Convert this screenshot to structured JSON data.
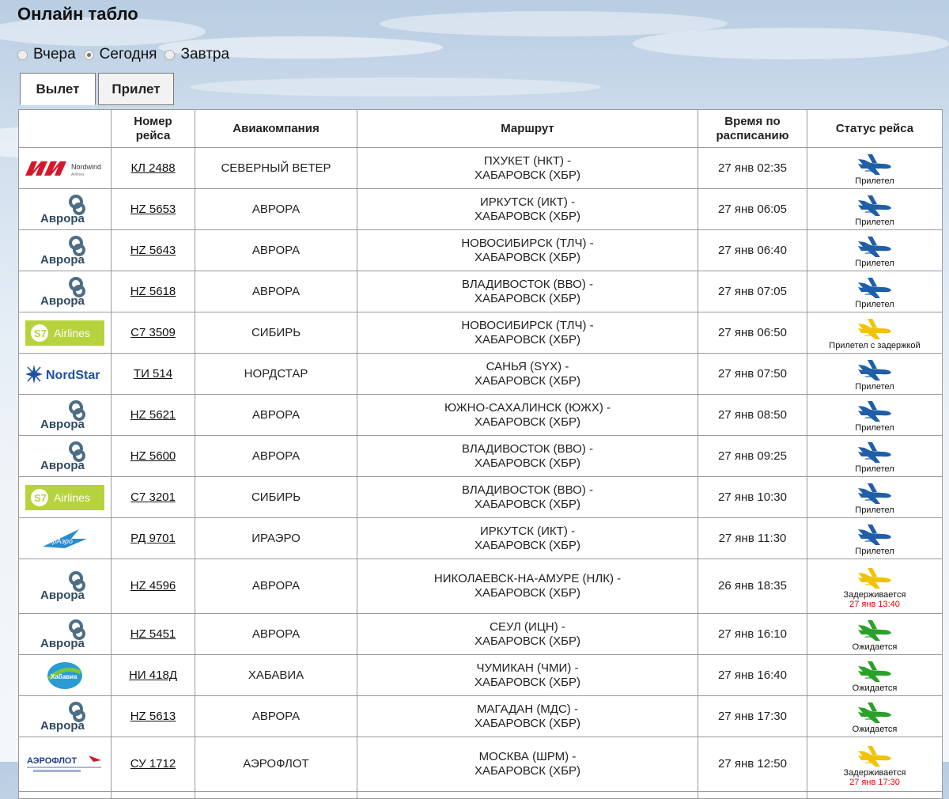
{
  "page": {
    "title": "Онлайн табло",
    "days": [
      {
        "label": "Вчера",
        "selected": false
      },
      {
        "label": "Сегодня",
        "selected": true
      },
      {
        "label": "Завтра",
        "selected": false
      }
    ],
    "tabs": [
      {
        "label": "Вылет",
        "active": true
      },
      {
        "label": "Прилет",
        "active": false
      }
    ]
  },
  "table": {
    "headers": {
      "logo": "",
      "flight": "Номер рейса",
      "airline": "Авиакомпания",
      "route": "Маршрут",
      "time": "Время по расписанию",
      "status": "Статус рейса"
    },
    "rows": [
      {
        "logo": "nordwind-logo",
        "logo_text": "Nordwind",
        "flight": "КЛ 2488",
        "airline": "СЕВЕРНЫЙ ВЕТЕР",
        "route1": "ПХУКЕТ (НКТ) -",
        "route2": "ХАБАРОВСК (ХБР)",
        "time": "27 янв 02:35",
        "status": "Прилетел",
        "status_color": "#1f5fa8",
        "status_time": ""
      },
      {
        "logo": "aurora-logo",
        "logo_text": "Аврора",
        "flight": "HZ 5653",
        "airline": "АВРОРА",
        "route1": "ИРКУТСК (ИКТ) -",
        "route2": "ХАБАРОВСК (ХБР)",
        "time": "27 янв 06:05",
        "status": "Прилетел",
        "status_color": "#1f5fa8",
        "status_time": ""
      },
      {
        "logo": "aurora-logo",
        "logo_text": "Аврора",
        "flight": "HZ 5643",
        "airline": "АВРОРА",
        "route1": "НОВОСИБИРСК (ТЛЧ) -",
        "route2": "ХАБАРОВСК (ХБР)",
        "time": "27 янв 06:40",
        "status": "Прилетел",
        "status_color": "#1f5fa8",
        "status_time": ""
      },
      {
        "logo": "aurora-logo",
        "logo_text": "Аврора",
        "flight": "HZ 5618",
        "airline": "АВРОРА",
        "route1": "ВЛАДИВОСТОК (ВВО) -",
        "route2": "ХАБАРОВСК (ХБР)",
        "time": "27 янв 07:05",
        "status": "Прилетел",
        "status_color": "#1f5fa8",
        "status_time": ""
      },
      {
        "logo": "s7-logo",
        "logo_text": "Airlines",
        "flight": "С7 3509",
        "airline": "СИБИРЬ",
        "route1": "НОВОСИБИРСК (ТЛЧ) -",
        "route2": "ХАБАРОВСК (ХБР)",
        "time": "27 янв 06:50",
        "status": "Прилетел с задержкой",
        "status_color": "#f2c200",
        "status_time": ""
      },
      {
        "logo": "nordstar-logo",
        "logo_text": "NordStar",
        "flight": "ТИ 514",
        "airline": "НОРДСТАР",
        "route1": "САНЬЯ (SYX) -",
        "route2": "ХАБАРОВСК (ХБР)",
        "time": "27 янв 07:50",
        "status": "Прилетел",
        "status_color": "#1f5fa8",
        "status_time": ""
      },
      {
        "logo": "aurora-logo",
        "logo_text": "Аврора",
        "flight": "HZ 5621",
        "airline": "АВРОРА",
        "route1": "ЮЖНО-САХАЛИНСК (ЮЖХ) -",
        "route2": "ХАБАРОВСК (ХБР)",
        "time": "27 янв 08:50",
        "status": "Прилетел",
        "status_color": "#1f5fa8",
        "status_time": ""
      },
      {
        "logo": "aurora-logo",
        "logo_text": "Аврора",
        "flight": "HZ 5600",
        "airline": "АВРОРА",
        "route1": "ВЛАДИВОСТОК (ВВО) -",
        "route2": "ХАБАРОВСК (ХБР)",
        "time": "27 янв 09:25",
        "status": "Прилетел",
        "status_color": "#1f5fa8",
        "status_time": ""
      },
      {
        "logo": "s7-logo",
        "logo_text": "Airlines",
        "flight": "С7 3201",
        "airline": "СИБИРЬ",
        "route1": "ВЛАДИВОСТОК (ВВО) -",
        "route2": "ХАБАРОВСК (ХБР)",
        "time": "27 янв 10:30",
        "status": "Прилетел",
        "status_color": "#1f5fa8",
        "status_time": ""
      },
      {
        "logo": "iraero-logo",
        "logo_text": "ИрАэро",
        "flight": "РД 9701",
        "airline": "ИРАЭРО",
        "route1": "ИРКУТСК (ИКТ) -",
        "route2": "ХАБАРОВСК (ХБР)",
        "time": "27 янв 11:30",
        "status": "Прилетел",
        "status_color": "#1f5fa8",
        "status_time": ""
      },
      {
        "logo": "aurora-logo",
        "logo_text": "Аврора",
        "flight": "HZ 4596",
        "airline": "АВРОРА",
        "route1": "НИКОЛАЕВСК-НА-АМУРЕ (НЛК) -",
        "route2": "ХАБАРОВСК (ХБР)",
        "time": "26 янв 18:35",
        "status": "Задерживается",
        "status_color": "#f2c200",
        "status_time": "27 янв 13:40",
        "tall": true
      },
      {
        "logo": "aurora-logo",
        "logo_text": "Аврора",
        "flight": "HZ 5451",
        "airline": "АВРОРА",
        "route1": "СЕУЛ (ИЦН) -",
        "route2": "ХАБАРОВСК (ХБР)",
        "time": "27 янв 16:10",
        "status": "Ожидается",
        "status_color": "#2aa12a",
        "status_time": ""
      },
      {
        "logo": "khabavia-logo",
        "logo_text": "Хабавиа",
        "flight": "НИ 418Д",
        "airline": "ХАБАВИА",
        "route1": "ЧУМИКАН (ЧМИ) -",
        "route2": "ХАБАРОВСК (ХБР)",
        "time": "27 янв 16:40",
        "status": "Ожидается",
        "status_color": "#2aa12a",
        "status_time": ""
      },
      {
        "logo": "aurora-logo",
        "logo_text": "Аврора",
        "flight": "HZ 5613",
        "airline": "АВРОРА",
        "route1": "МАГАДАН (МДС) -",
        "route2": "ХАБАРОВСК (ХБР)",
        "time": "27 янв 17:30",
        "status": "Ожидается",
        "status_color": "#2aa12a",
        "status_time": ""
      },
      {
        "logo": "aeroflot-logo",
        "logo_text": "АЭРОФЛОТ",
        "flight": "СУ 1712",
        "airline": "АЭРОФЛОТ",
        "route1": "МОСКВА (ШРМ) -",
        "route2": "ХАБАРОВСК (ХБР)",
        "time": "27 янв 12:50",
        "status": "Задерживается",
        "status_color": "#f2c200",
        "status_time": "27 янв 17:30",
        "tall": true
      }
    ]
  }
}
